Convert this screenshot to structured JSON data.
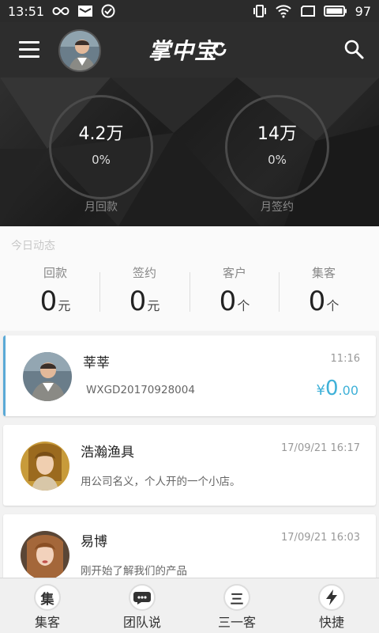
{
  "status_bar": {
    "time": "13:51",
    "battery": "97"
  },
  "header": {
    "brand": "掌中宝",
    "menu_icon": "hamburger-icon",
    "search_icon": "search-icon",
    "refresh_icon": "refresh-icon"
  },
  "summary": {
    "payment": {
      "value": "4.2万",
      "percent": "0%",
      "label": "月回款"
    },
    "signing": {
      "value": "14万",
      "percent": "0%",
      "label": "月签约"
    }
  },
  "today": {
    "title": "今日动态",
    "stats": [
      {
        "label": "回款",
        "value": "0",
        "unit": "元"
      },
      {
        "label": "签约",
        "value": "0",
        "unit": "元"
      },
      {
        "label": "客户",
        "value": "0",
        "unit": "个"
      },
      {
        "label": "集客",
        "value": "0",
        "unit": "个"
      }
    ]
  },
  "feed": [
    {
      "name": "莘莘",
      "time": "11:16",
      "detail": "WXGD20170928004",
      "currency": "¥",
      "amount_int": "0",
      "amount_dec": ".00"
    },
    {
      "name": "浩瀚渔具",
      "time": "17/09/21 16:17",
      "detail": "用公司名义，个人开的一个小店。"
    },
    {
      "name": "易博",
      "time": "17/09/21 16:03",
      "detail": "刚开始了解我们的产品"
    }
  ],
  "tabs": [
    {
      "label": "集客",
      "icon_text": "集",
      "icon": "collect-icon"
    },
    {
      "label": "团队说",
      "icon_text": "",
      "icon": "chat-icon"
    },
    {
      "label": "三一客",
      "icon_text": "三",
      "icon": "sanyi-icon"
    },
    {
      "label": "快捷",
      "icon_text": "",
      "icon": "lightning-icon"
    }
  ],
  "colors": {
    "accent": "#3fb1d8",
    "active_border": "#5aa9d6",
    "appbar": "#2d2d2d"
  }
}
